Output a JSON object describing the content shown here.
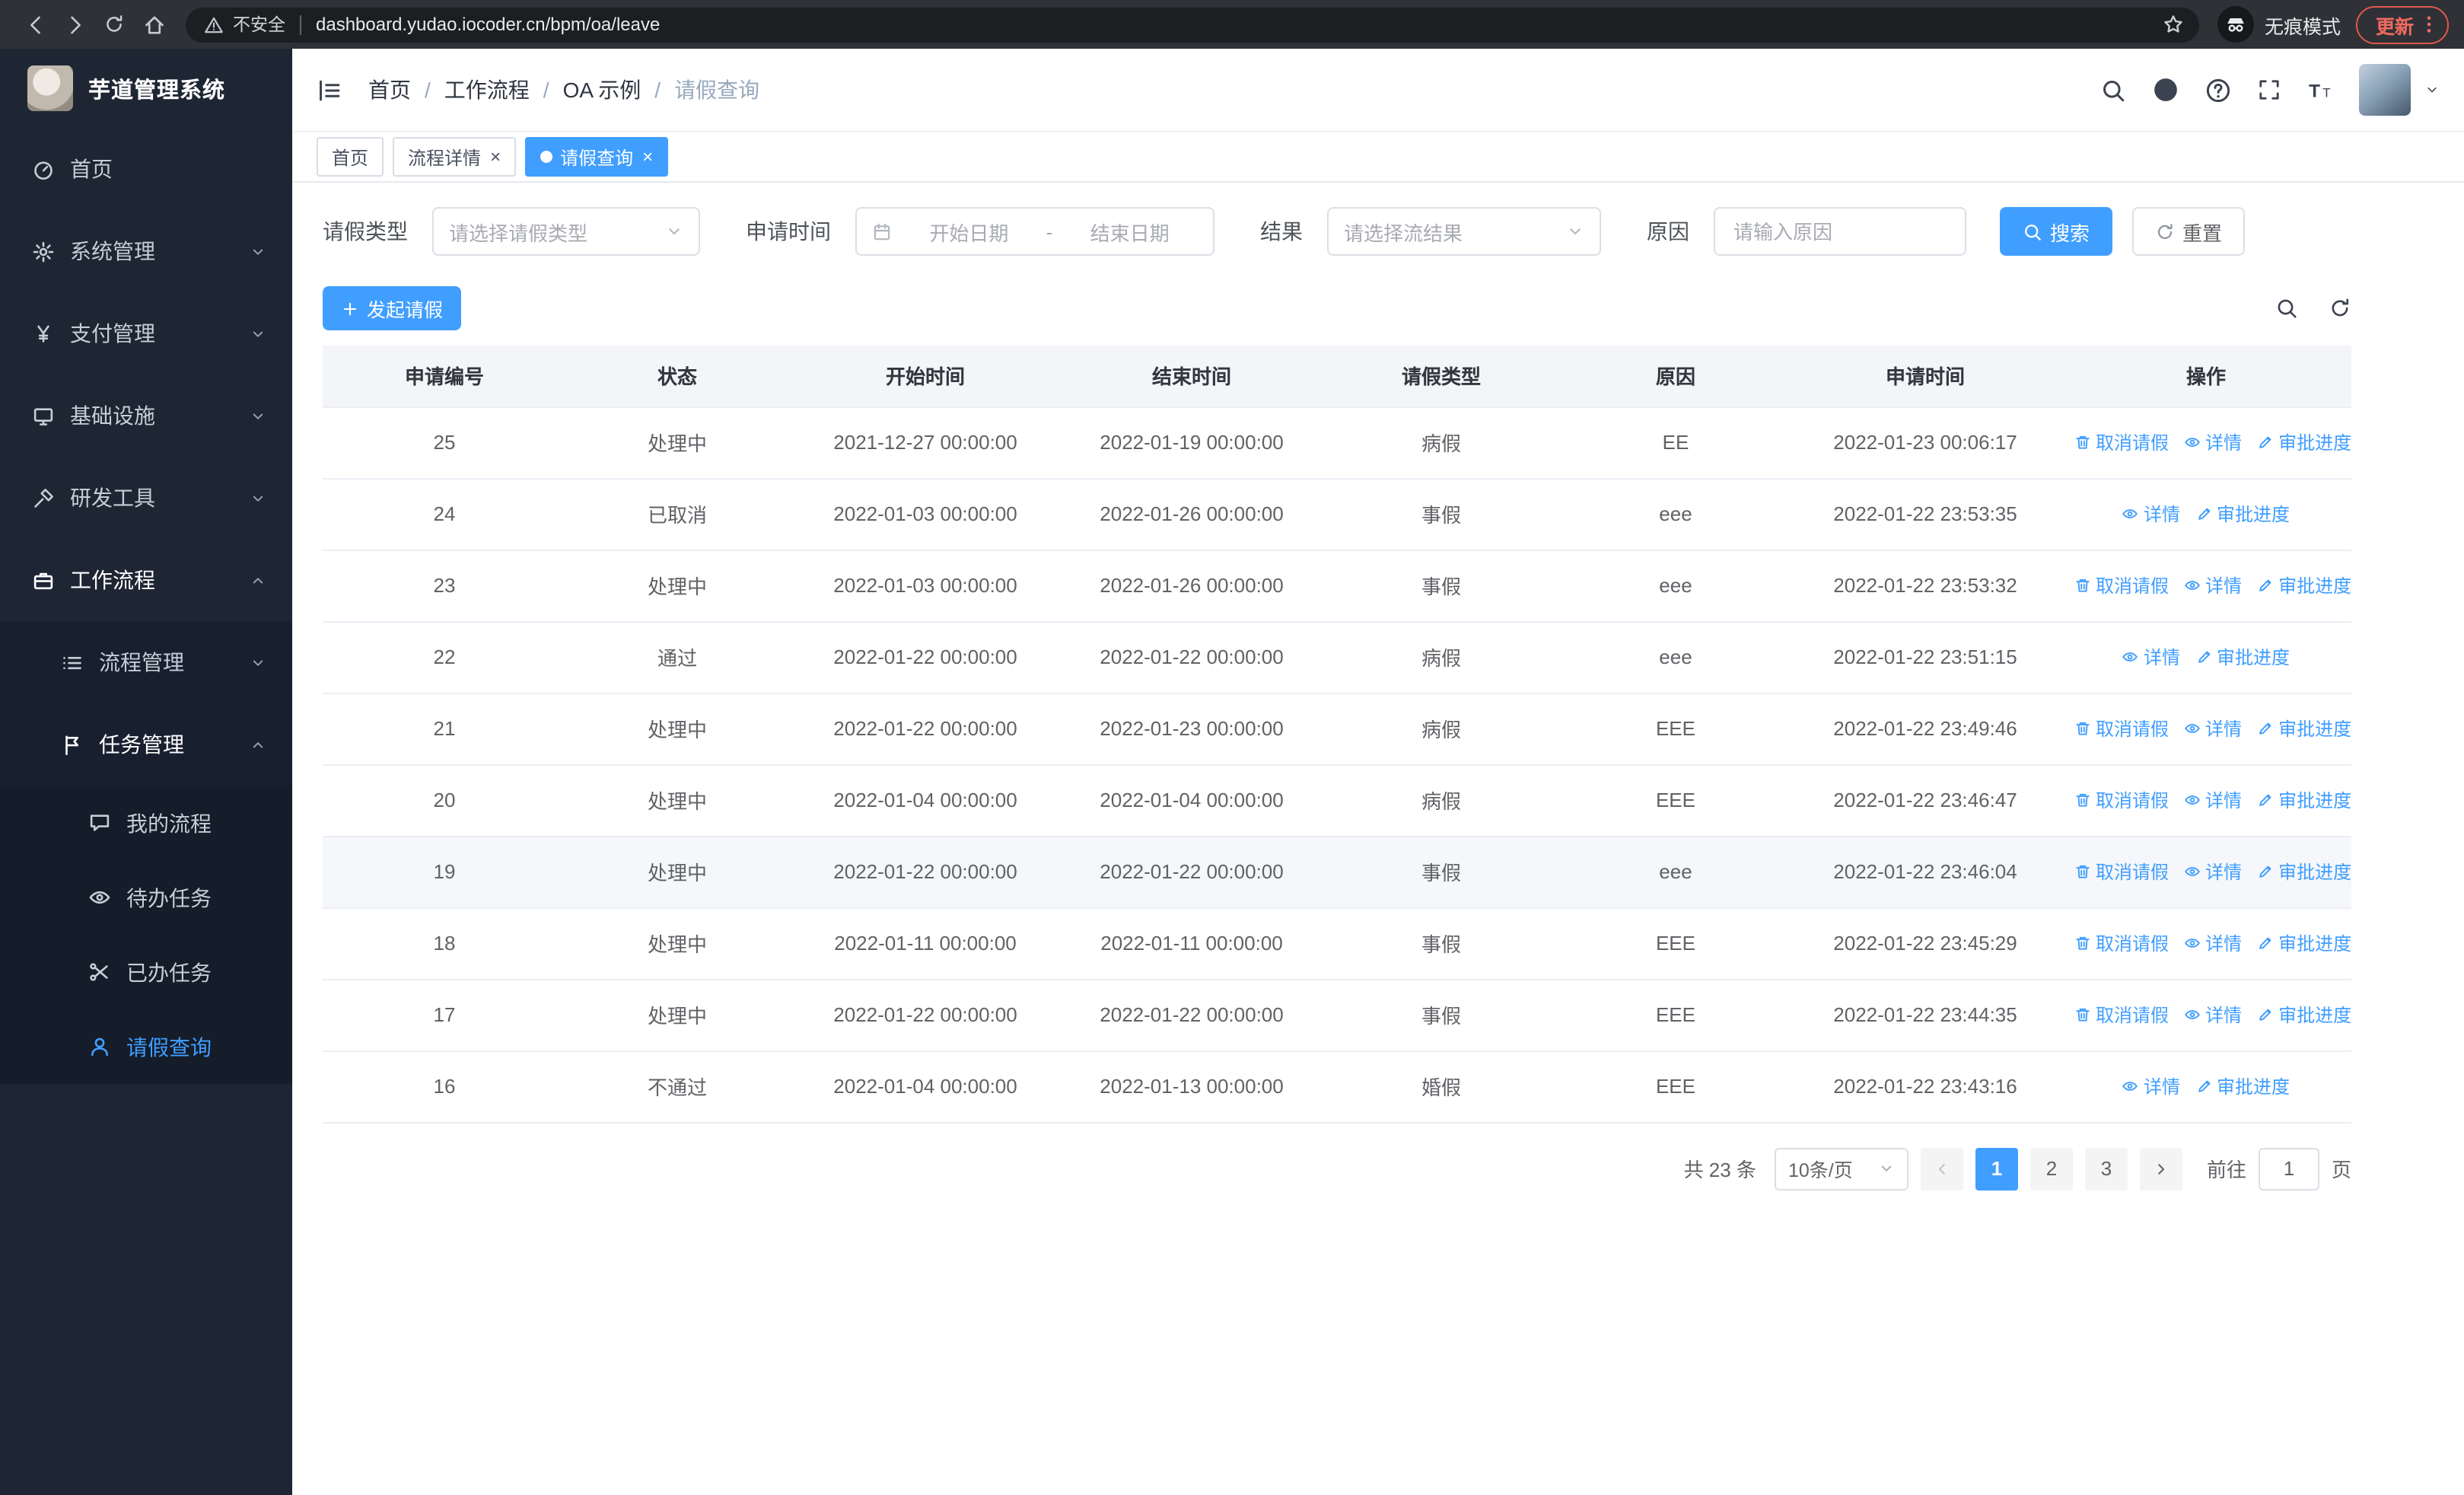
{
  "browser": {
    "security_warning": "不安全",
    "url": "dashboard.yudao.iocoder.cn/bpm/oa/leave",
    "incognito_label": "无痕模式",
    "update_label": "更新"
  },
  "sidebar": {
    "logo_title": "芋道管理系统",
    "items": [
      {
        "key": "home",
        "label": "首页",
        "icon": "dashboard",
        "level": 1
      },
      {
        "key": "system",
        "label": "系统管理",
        "icon": "gear",
        "level": 1,
        "arrow": "down"
      },
      {
        "key": "payment",
        "label": "支付管理",
        "icon": "yen",
        "level": 1,
        "arrow": "down"
      },
      {
        "key": "infra",
        "label": "基础设施",
        "icon": "monitor",
        "level": 1,
        "arrow": "down"
      },
      {
        "key": "devtools",
        "label": "研发工具",
        "icon": "tools",
        "level": 1,
        "arrow": "down"
      },
      {
        "key": "workflow",
        "label": "工作流程",
        "icon": "briefcase",
        "level": 1,
        "arrow": "up",
        "open": true
      },
      {
        "key": "process-mgmt",
        "label": "流程管理",
        "icon": "list",
        "level": 2,
        "arrow": "down"
      },
      {
        "key": "task-mgmt",
        "label": "任务管理",
        "icon": "flag",
        "level": 2,
        "arrow": "up",
        "open": true
      },
      {
        "key": "my-process",
        "label": "我的流程",
        "icon": "chat",
        "level": 3
      },
      {
        "key": "todo-task",
        "label": "待办任务",
        "icon": "eye",
        "level": 3
      },
      {
        "key": "done-task",
        "label": "已办任务",
        "icon": "scissors",
        "level": 3
      },
      {
        "key": "leave-query",
        "label": "请假查询",
        "icon": "user",
        "level": 3,
        "active": true
      }
    ]
  },
  "header": {
    "breadcrumb": [
      "首页",
      "工作流程",
      "OA 示例",
      "请假查询"
    ]
  },
  "tabs": [
    {
      "key": "home",
      "label": "首页"
    },
    {
      "key": "process-detail",
      "label": "流程详情",
      "closable": true
    },
    {
      "key": "leave-query",
      "label": "请假查询",
      "closable": true,
      "active": true
    }
  ],
  "filters": {
    "leave_type_label": "请假类型",
    "leave_type_placeholder": "请选择请假类型",
    "apply_time_label": "申请时间",
    "start_date_placeholder": "开始日期",
    "date_separator": "-",
    "end_date_placeholder": "结束日期",
    "result_label": "结果",
    "result_placeholder": "请选择流结果",
    "reason_label": "原因",
    "reason_placeholder": "请输入原因",
    "search_button": "搜索",
    "reset_button": "重置"
  },
  "toolbar": {
    "create_button": "发起请假"
  },
  "table": {
    "columns": [
      "申请编号",
      "状态",
      "开始时间",
      "结束时间",
      "请假类型",
      "原因",
      "申请时间",
      "操作"
    ],
    "action_labels": {
      "cancel": "取消请假",
      "detail": "详情",
      "progress": "审批进度"
    },
    "rows": [
      {
        "id": "25",
        "status": "处理中",
        "start": "2021-12-27 00:00:00",
        "end": "2022-01-19 00:00:00",
        "type": "病假",
        "reason": "EE",
        "applied": "2022-01-23 00:06:17",
        "actions": [
          "cancel",
          "detail",
          "progress"
        ]
      },
      {
        "id": "24",
        "status": "已取消",
        "start": "2022-01-03 00:00:00",
        "end": "2022-01-26 00:00:00",
        "type": "事假",
        "reason": "eee",
        "applied": "2022-01-22 23:53:35",
        "actions": [
          "detail",
          "progress"
        ]
      },
      {
        "id": "23",
        "status": "处理中",
        "start": "2022-01-03 00:00:00",
        "end": "2022-01-26 00:00:00",
        "type": "事假",
        "reason": "eee",
        "applied": "2022-01-22 23:53:32",
        "actions": [
          "cancel",
          "detail",
          "progress"
        ]
      },
      {
        "id": "22",
        "status": "通过",
        "start": "2022-01-22 00:00:00",
        "end": "2022-01-22 00:00:00",
        "type": "病假",
        "reason": "eee",
        "applied": "2022-01-22 23:51:15",
        "actions": [
          "detail",
          "progress"
        ]
      },
      {
        "id": "21",
        "status": "处理中",
        "start": "2022-01-22 00:00:00",
        "end": "2022-01-23 00:00:00",
        "type": "病假",
        "reason": "EEE",
        "applied": "2022-01-22 23:49:46",
        "actions": [
          "cancel",
          "detail",
          "progress"
        ]
      },
      {
        "id": "20",
        "status": "处理中",
        "start": "2022-01-04 00:00:00",
        "end": "2022-01-04 00:00:00",
        "type": "病假",
        "reason": "EEE",
        "applied": "2022-01-22 23:46:47",
        "actions": [
          "cancel",
          "detail",
          "progress"
        ]
      },
      {
        "id": "19",
        "status": "处理中",
        "start": "2022-01-22 00:00:00",
        "end": "2022-01-22 00:00:00",
        "type": "事假",
        "reason": "eee",
        "applied": "2022-01-22 23:46:04",
        "actions": [
          "cancel",
          "detail",
          "progress"
        ],
        "hover": true
      },
      {
        "id": "18",
        "status": "处理中",
        "start": "2022-01-11 00:00:00",
        "end": "2022-01-11 00:00:00",
        "type": "事假",
        "reason": "EEE",
        "applied": "2022-01-22 23:45:29",
        "actions": [
          "cancel",
          "detail",
          "progress"
        ]
      },
      {
        "id": "17",
        "status": "处理中",
        "start": "2022-01-22 00:00:00",
        "end": "2022-01-22 00:00:00",
        "type": "事假",
        "reason": "EEE",
        "applied": "2022-01-22 23:44:35",
        "actions": [
          "cancel",
          "detail",
          "progress"
        ]
      },
      {
        "id": "16",
        "status": "不通过",
        "start": "2022-01-04 00:00:00",
        "end": "2022-01-13 00:00:00",
        "type": "婚假",
        "reason": "EEE",
        "applied": "2022-01-22 23:43:16",
        "actions": [
          "detail",
          "progress"
        ]
      }
    ]
  },
  "pagination": {
    "total_text": "共 23 条",
    "page_size": "10条/页",
    "pages": [
      "1",
      "2",
      "3"
    ],
    "active_page": "1",
    "goto_label": "前往",
    "goto_value": "1",
    "page_unit": "页"
  },
  "colors": {
    "primary": "#409eff",
    "sidebar_bg": "#1e2634",
    "update_red": "#ef6a5e"
  }
}
